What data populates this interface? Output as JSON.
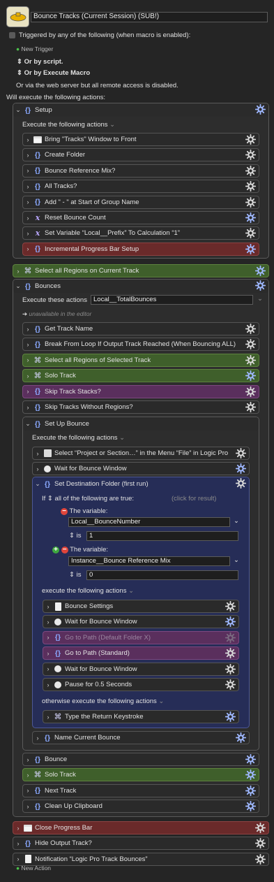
{
  "macro": {
    "name": "Bounce Tracks (Current Session) (SUB!)",
    "triggered_label": "Triggered by any of the following (when macro is enabled):",
    "new_trigger": "New Trigger",
    "or_by_script": "Or by script.",
    "or_by_execute_macro": "Or by Execute Macro",
    "web_server_note": "Or via the web server but all remote access is disabled.",
    "will_execute": "Will execute the following actions:",
    "new_action": "New Action"
  },
  "setup": {
    "title": "Setup",
    "execute_label": "Execute the following actions",
    "actions": [
      {
        "label": "Bring \"Tracks\" Window to Front",
        "icon": "window-icon"
      },
      {
        "label": "Create Folder",
        "icon": "braces-icon"
      },
      {
        "label": "Bounce Reference Mix?",
        "icon": "braces-icon"
      },
      {
        "label": "All Tracks?",
        "icon": "braces-icon"
      },
      {
        "label": "Add \" - \" at Start of Group Name",
        "icon": "braces-icon"
      },
      {
        "label": "Reset Bounce Count",
        "icon": "variable-icon"
      },
      {
        "label": "Set Variable “Local__Prefix” To Calculation “1”",
        "icon": "variable-icon"
      },
      {
        "label": "Incremental Progress Bar Setup",
        "icon": "braces-icon"
      }
    ]
  },
  "select_all_regions": "Select all Regions on Current Track",
  "bounces": {
    "title": "Bounces",
    "execute_these": "Execute these actions",
    "execute_value": "Local__TotalBounces",
    "unavailable": "unavailable in the editor",
    "actions": [
      {
        "label": "Get Track Name"
      },
      {
        "label": "Break From Loop If Output Track Reached (When Bouncing ALL)"
      },
      {
        "label": "Select all Regions of Selected Track"
      },
      {
        "label": "Solo Track"
      },
      {
        "label": "Skip Track Stacks?"
      },
      {
        "label": "Skip Tracks Without Regions?"
      }
    ],
    "setup_bounce": {
      "title": "Set Up Bounce",
      "execute_label": "Execute the following actions",
      "menu_action": "Select “Project or Section…” in the Menu “File” in Logic Pro",
      "wait_action": "Wait for Bounce Window",
      "dest": {
        "title": "Set Destination Folder (first run)",
        "if_label": "If",
        "all_label": "all of the following are true:",
        "click_result": "(click for result)",
        "conditions": [
          {
            "label": "The variable:",
            "variable": "Local__BounceNumber",
            "op": "is",
            "value": "1"
          },
          {
            "label": "The variable:",
            "variable": "Instance__Bounce Reference Mix",
            "op": "is",
            "value": "0"
          }
        ],
        "then_label": "execute the following actions",
        "then_actions": [
          {
            "label": "Bounce Settings"
          },
          {
            "label": "Wait for Bounce Window"
          },
          {
            "label": "Go to Path (Default Folder X)"
          },
          {
            "label": "Go to Path (Standard)"
          },
          {
            "label": "Wait for Bounce Window"
          },
          {
            "label": "Pause for 0.5 Seconds"
          }
        ],
        "else_label": "otherwise execute the following actions",
        "else_actions": [
          {
            "label": "Type the Return Keystroke"
          }
        ]
      },
      "name_current": "Name Current Bounce"
    },
    "tail_actions": [
      {
        "label": "Bounce"
      },
      {
        "label": "Solo Track"
      },
      {
        "label": "Next Track"
      },
      {
        "label": "Clean Up Clipboard"
      }
    ]
  },
  "bottom_actions": [
    {
      "label": "Close Progress Bar"
    },
    {
      "label": "Hide Output Track?"
    },
    {
      "label": "Notification “Logic Pro Track Bounces”"
    }
  ],
  "colors": {
    "red": "#6a2a2a",
    "green": "#3f5f2b",
    "purple": "#5a2f5d",
    "navy": "#252d55",
    "gear": "#9fb8ff"
  }
}
